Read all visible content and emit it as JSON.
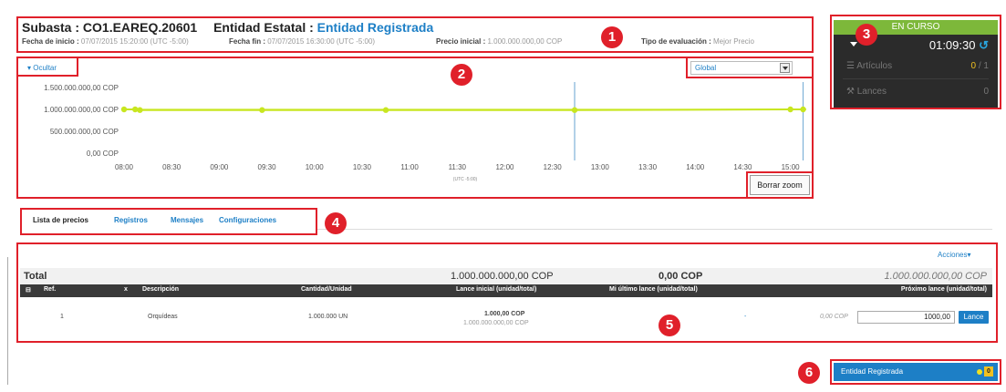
{
  "header": {
    "subasta_label": "Subasta : ",
    "subasta_code": "CO1.EAREQ.20601",
    "entidad_label": "Entidad Estatal : ",
    "entidad_value": "Entidad Registrada",
    "fecha_inicio_label": "Fecha de inicio : ",
    "fecha_inicio_value": "07/07/2015 15:20:00 (UTC -5:00)",
    "fecha_fin_label": "Fecha fin : ",
    "fecha_fin_value": "07/07/2015 16:30:00 (UTC -5:00)",
    "precio_label": "Precio inicial : ",
    "precio_value": "1.000.000.000,00 COP",
    "tipo_label": "Tipo de evaluación : ",
    "tipo_value": "Mejor Precio"
  },
  "chart_panel": {
    "ocultar": "▾ Ocultar",
    "select_value": "Global",
    "borrar_zoom": "Borrar zoom",
    "tz_label": "(UTC -5:00)"
  },
  "chart_data": {
    "type": "line",
    "x_ticks": [
      "08:00",
      "08:30",
      "09:00",
      "09:30",
      "10:00",
      "10:30",
      "11:00",
      "11:30",
      "12:00",
      "12:30",
      "13:00",
      "13:30",
      "14:00",
      "14:30",
      "15:00"
    ],
    "y_ticks": [
      "0,00 COP",
      "500.000.000,00 COP",
      "1.000.000.000,00 COP",
      "1.500.000.000,00 COP"
    ],
    "y_tick_values": [
      0,
      500000000,
      1000000000,
      1500000000
    ],
    "ylim": [
      0,
      1500000000
    ],
    "xlim_minutes": [
      480,
      910
    ],
    "series": [
      {
        "color": "#c8e620",
        "x_minutes": [
          480,
          487,
          490,
          567,
          645,
          764,
          900,
          908
        ],
        "y": [
          1000000000,
          1000000000,
          985000000,
          985000000,
          985000000,
          985000000,
          1000000000,
          1000000000
        ]
      }
    ],
    "vertical_markers_minutes": [
      764,
      908
    ],
    "marker_color": "#7fb2d8"
  },
  "status": {
    "state": "EN CURSO",
    "timer": "01:09:30",
    "clock_icon": "↺",
    "articulos_label": "Artículos",
    "articulos_done": "0",
    "articulos_total": " / 1",
    "lances_label": "Lances",
    "lances_count": "0"
  },
  "tabs": [
    "Lista de precios",
    "Registros",
    "Mensajes",
    "Configuraciones"
  ],
  "table": {
    "acciones": "Acciones▾",
    "total_label": "Total",
    "total_lance_inicial": "1.000.000.000,00 COP",
    "total_mi_ultimo": "0,00 COP",
    "total_proximo": "1.000.000.000,00 COP",
    "headers": [
      "Ref.",
      "x",
      "Descripción",
      "Cantidad/Unidad",
      "Lance inicial (unidad/total)",
      "Mi último lance (unidad/total)",
      "Próximo lance (unidad/total)"
    ],
    "row": {
      "ref": "1",
      "descripcion": "Orquídeas",
      "cantidad": "1.000.000 UN",
      "lance_unidad": "1.000,00 COP",
      "lance_total": "1.000.000.000,00 COP",
      "mi_ultimo": "-",
      "proximo_prefix": "0,00 COP",
      "input_value": "1000,00",
      "lance_button": "Lance"
    }
  },
  "footer": {
    "entidad": "Entidad Registrada",
    "notif_count": "0"
  },
  "callouts": [
    "1",
    "2",
    "3",
    "4",
    "5",
    "6"
  ]
}
